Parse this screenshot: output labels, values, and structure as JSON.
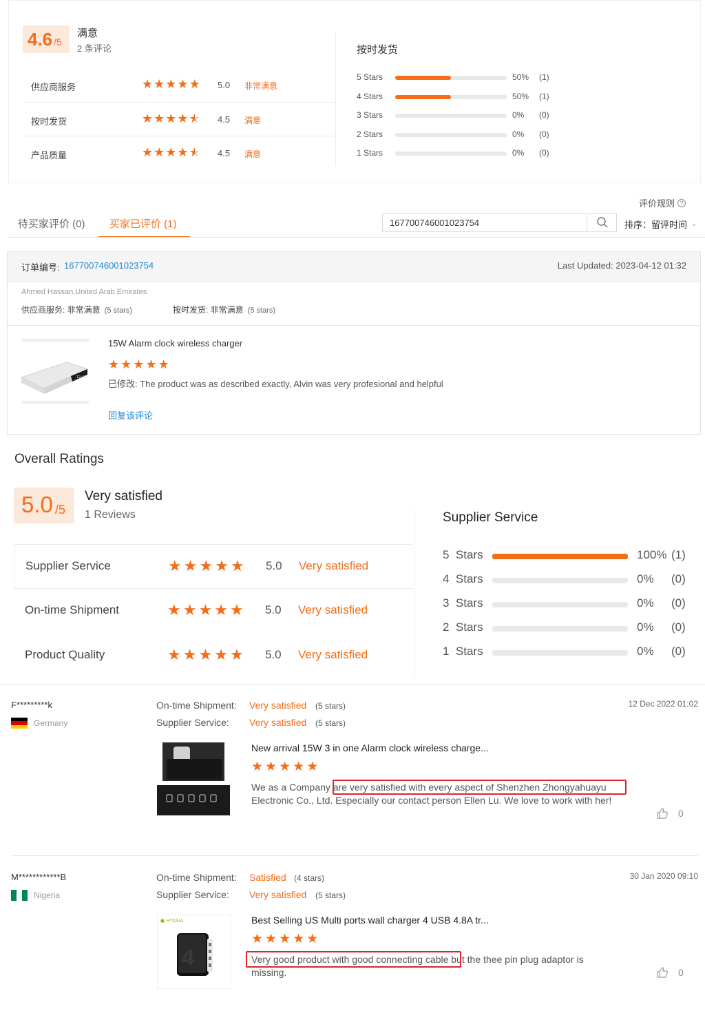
{
  "top_summary": {
    "score": "4.6",
    "score_suffix": "/5",
    "sentiment": "满意",
    "count_label": "2 条评论",
    "rows": [
      {
        "label": "供应商服务",
        "rating": 5.0,
        "value": "5.0",
        "sentiment": "非常满意"
      },
      {
        "label": "按时发货",
        "rating": 4.5,
        "value": "4.5",
        "sentiment": "满意"
      },
      {
        "label": "产品质量",
        "rating": 4.5,
        "value": "4.5",
        "sentiment": "满意"
      }
    ],
    "dist_title": "按时发货",
    "distribution": [
      {
        "label": "5 Stars",
        "fraction": 0.5,
        "pct": "50%",
        "count": "(1)"
      },
      {
        "label": "4 Stars",
        "fraction": 0.5,
        "pct": "50%",
        "count": "(1)"
      },
      {
        "label": "3 Stars",
        "fraction": 0,
        "pct": "0%",
        "count": "(0)"
      },
      {
        "label": "2 Stars",
        "fraction": 0,
        "pct": "0%",
        "count": "(0)"
      },
      {
        "label": "1 Stars",
        "fraction": 0,
        "pct": "0%",
        "count": "(0)"
      }
    ]
  },
  "toolbar": {
    "rules_label": "评价规则",
    "tab_pending": "待买家评价 (0)",
    "tab_reviewed": "买家已评价 (1)",
    "search_value": "167700746001023754",
    "sort_label": "排序：留评时间"
  },
  "order": {
    "order_label": "订单编号:",
    "order_number": "167700746001023754",
    "last_updated": "Last Updated: 2023-04-12 01:32",
    "buyer": "Ahmed Hassan,United Arab Emirates",
    "supplier_service": "供应商服务: 非常满意",
    "supplier_stars": "(5 stars)",
    "shipment": "按时发货: 非常满意",
    "shipment_stars": "(5 stars)",
    "product_title": "15W Alarm clock wireless charger",
    "product_rating": 5,
    "review_text": "已修改: The product was as described exactly, Alvin was very profesional and helpful",
    "reply_link": "回复该评论"
  },
  "overall": {
    "heading": "Overall Ratings",
    "score": "5.0",
    "score_suffix": "/5",
    "sentiment": "Very satisfied",
    "count_label": "1 Reviews",
    "rows": [
      {
        "label": "Supplier Service",
        "rating": 5,
        "value": "5.0",
        "sentiment": "Very satisfied"
      },
      {
        "label": "On-time Shipment",
        "rating": 5,
        "value": "5.0",
        "sentiment": "Very satisfied"
      },
      {
        "label": "Product Quality",
        "rating": 5,
        "value": "5.0",
        "sentiment": "Very satisfied"
      }
    ],
    "dist_title": "Supplier Service",
    "distribution": [
      {
        "label": "5  Stars",
        "fraction": 1.0,
        "pct": "100%",
        "count": "(1)"
      },
      {
        "label": "4  Stars",
        "fraction": 0,
        "pct": "0%",
        "count": "(0)"
      },
      {
        "label": "3  Stars",
        "fraction": 0,
        "pct": "0%",
        "count": "(0)"
      },
      {
        "label": "2  Stars",
        "fraction": 0,
        "pct": "0%",
        "count": "(0)"
      },
      {
        "label": "1  Stars",
        "fraction": 0,
        "pct": "0%",
        "count": "(0)"
      }
    ]
  },
  "reviews": [
    {
      "user": "F*********k",
      "country": "Germany",
      "date": "12 Dec 2022 01:02",
      "shipment_label": "On-time Shipment:",
      "shipment_value": "Very satisfied",
      "shipment_stars": "(5 stars)",
      "service_label": "Supplier Service:",
      "service_value": "Very satisfied",
      "service_stars": "(5 stars)",
      "product_title": "New arrival 15W 3 in one Alarm clock wireless charge...",
      "rating": 5,
      "text_pre": "We as a Company ",
      "text_highlight": "are very satisfied with  every aspect of Shenzhen Zhongyahuay",
      "text_post": "u Electronic Co., Ltd. Especially our contact person Ellen Lu. We love to work with her!",
      "likes": "0"
    },
    {
      "user": "M************B",
      "country": "Nigeria",
      "date": "30 Jan 2020 09:10",
      "shipment_label": "On-time Shipment:",
      "shipment_value": "Satisfied",
      "shipment_stars": "(4 stars)",
      "service_label": "Supplier Service:",
      "service_value": "Very satisfied",
      "service_stars": "(5 stars)",
      "product_title": "Best Selling US Multi ports wall charger 4 USB 4.8A tr...",
      "rating": 5,
      "text_highlight": "Very good product with good connecting cable",
      "text_post": " but the thee pin plug adaptor is missing.",
      "likes": "0"
    }
  ]
}
